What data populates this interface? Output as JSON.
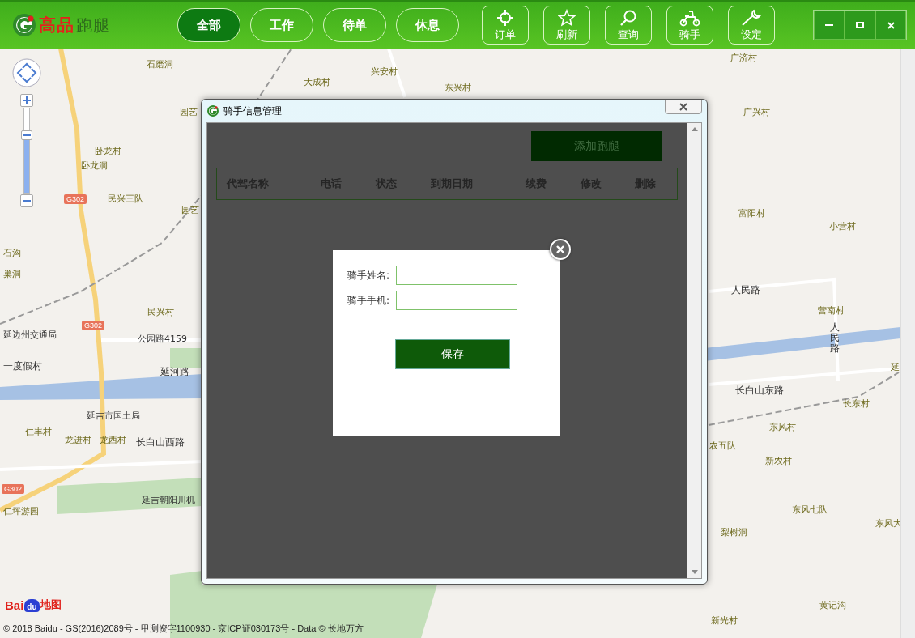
{
  "app": {
    "logo_brand": "高品",
    "logo_product": "跑腿"
  },
  "tabs": [
    {
      "label": "全部",
      "selected": true
    },
    {
      "label": "工作",
      "selected": false
    },
    {
      "label": "待单",
      "selected": false
    },
    {
      "label": "休息",
      "selected": false
    }
  ],
  "tools": [
    {
      "kind": "order",
      "label": "订单"
    },
    {
      "kind": "refresh",
      "label": "刷新"
    },
    {
      "kind": "search",
      "label": "查询"
    },
    {
      "kind": "rider",
      "label": "骑手"
    },
    {
      "kind": "settings",
      "label": "设定"
    }
  ],
  "map": {
    "labels": [
      {
        "text": "石磨洞",
        "kind": "place"
      },
      {
        "text": "大成村",
        "kind": "place"
      },
      {
        "text": "兴安村",
        "kind": "place"
      },
      {
        "text": "东兴村",
        "kind": "place"
      },
      {
        "text": "广济村",
        "kind": "place"
      },
      {
        "text": "园艺",
        "kind": "place"
      },
      {
        "text": "广兴村",
        "kind": "place"
      },
      {
        "text": "卧龙村",
        "kind": "place"
      },
      {
        "text": "卧龙洞",
        "kind": "place"
      },
      {
        "text": "民兴三队",
        "kind": "place"
      },
      {
        "text": "园艺",
        "kind": "place"
      },
      {
        "text": "富阳村",
        "kind": "place"
      },
      {
        "text": "小营村",
        "kind": "place"
      },
      {
        "text": "石沟",
        "kind": "place"
      },
      {
        "text": "巢洞",
        "kind": "place"
      },
      {
        "text": "人民路",
        "kind": "road"
      },
      {
        "text": "营南村",
        "kind": "place"
      },
      {
        "text": "民兴村",
        "kind": "place"
      },
      {
        "text": "延边州交通局",
        "kind": "poi"
      },
      {
        "text": "公园路4159",
        "kind": "park"
      },
      {
        "text": "人民路",
        "kind": "vroad"
      },
      {
        "text": "一度假村",
        "kind": "road"
      },
      {
        "text": "延河路",
        "kind": "road"
      },
      {
        "text": "延",
        "kind": "place"
      },
      {
        "text": "长白山东路",
        "kind": "road"
      },
      {
        "text": "长东村",
        "kind": "place"
      },
      {
        "text": "延吉市国土局",
        "kind": "poi"
      },
      {
        "text": "东风村",
        "kind": "place"
      },
      {
        "text": "仁丰村",
        "kind": "place"
      },
      {
        "text": "龙进村",
        "kind": "place"
      },
      {
        "text": "龙西村",
        "kind": "place"
      },
      {
        "text": "长白山西路",
        "kind": "road"
      },
      {
        "text": "农五队",
        "kind": "place"
      },
      {
        "text": "新农村",
        "kind": "place"
      },
      {
        "text": "延吉朝阳川机",
        "kind": "airport"
      },
      {
        "text": "仁坪游园",
        "kind": "place"
      },
      {
        "text": "东风七队",
        "kind": "place"
      },
      {
        "text": "东风大",
        "kind": "place"
      },
      {
        "text": "梨树洞",
        "kind": "place"
      },
      {
        "text": "黄记沟",
        "kind": "place"
      },
      {
        "text": "新光村",
        "kind": "place"
      }
    ],
    "zoom": {
      "level": 0.62
    },
    "highway_badges": [
      "G302",
      "G302",
      "G302"
    ],
    "map_logo": {
      "latin": "Bai",
      "badge": "du",
      "chinese": "地图"
    },
    "copyright": "© 2018 Baidu - GS(2016)2089号 - 甲测资字1100930 - 京ICP证030173号 - Data © 长地万方"
  },
  "dialog": {
    "title": "骑手信息管理",
    "add_button": "添加跑腿",
    "columns": [
      "代驾名称",
      "电话",
      "状态",
      "到期日期",
      "续费",
      "修改",
      "删除"
    ]
  },
  "form": {
    "fields": [
      {
        "label": "骑手姓名:"
      },
      {
        "label": "骑手手机:"
      }
    ],
    "save_button": "保存"
  }
}
